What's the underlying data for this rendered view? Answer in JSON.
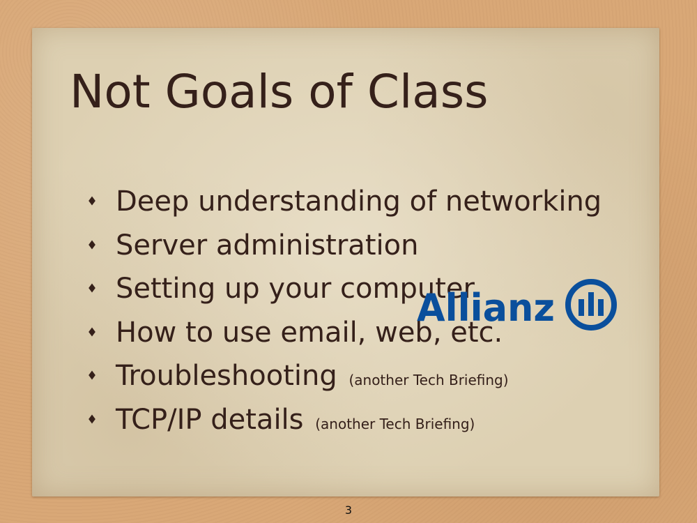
{
  "slide": {
    "title": "Not Goals of Class",
    "bullets": [
      {
        "text": "Deep understanding of networking",
        "note": ""
      },
      {
        "text": "Server administration",
        "note": ""
      },
      {
        "text": "Setting up your computer",
        "note": ""
      },
      {
        "text": "How to use email, web, etc.",
        "note": ""
      },
      {
        "text": "Troubleshooting",
        "note": "(another Tech Briefing)"
      },
      {
        "text": "TCP/IP details",
        "note": "(another Tech Briefing)"
      }
    ],
    "page_number": "3"
  },
  "logo": {
    "brand_text": "Allianz",
    "icon": "allianz-eagle-icon",
    "color": "#0a4f9c"
  },
  "colors": {
    "text": "#35201a",
    "background": "#d9a877",
    "card": "#ddd0b2"
  }
}
